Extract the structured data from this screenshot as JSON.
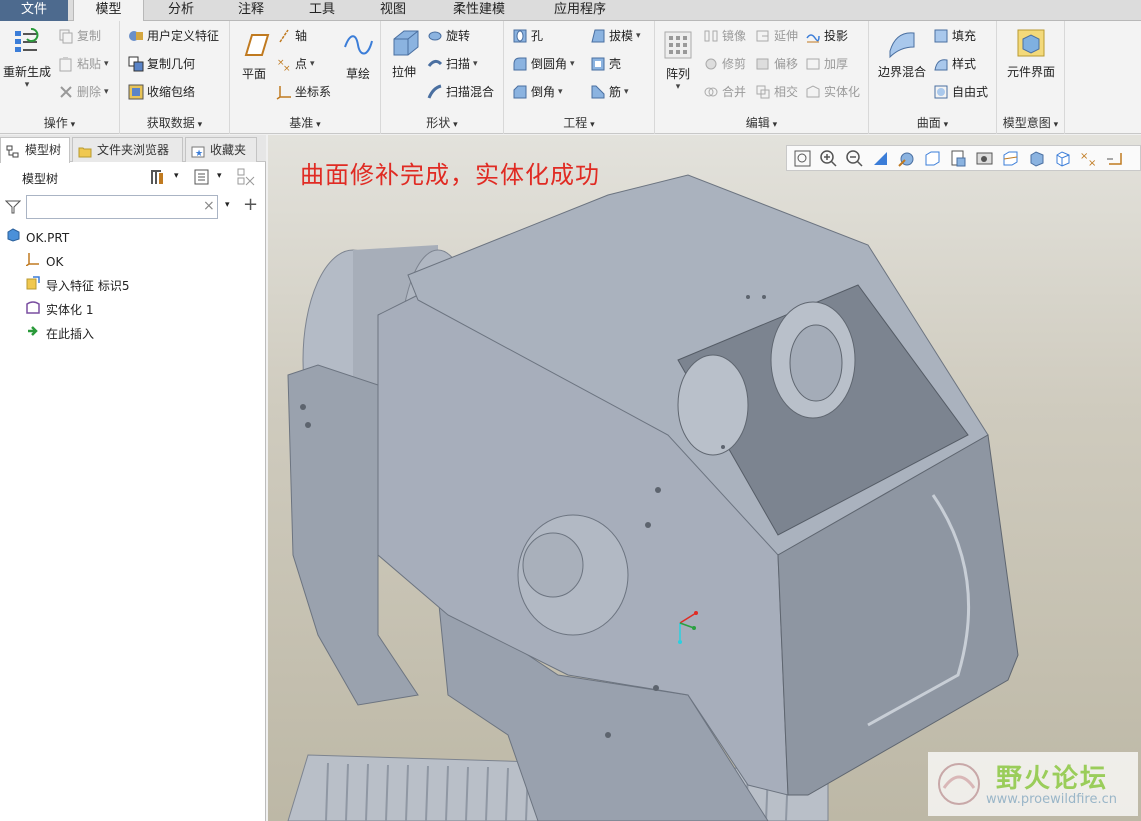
{
  "menu_tabs": [
    "文件",
    "模型",
    "分析",
    "注释",
    "工具",
    "视图",
    "柔性建模",
    "应用程序"
  ],
  "ribbon": {
    "groups": {
      "operations": "操作",
      "get_data": "获取数据",
      "datum": "基准",
      "shape": "形状",
      "engineering": "工程",
      "edit": "编辑",
      "surface": "曲面",
      "model_intent": "模型意图"
    },
    "regenerate": "重新生成",
    "copy": "复制",
    "paste": "粘贴",
    "delete": "删除",
    "udf": "用户定义特征",
    "copy_geometry": "复制几何",
    "shrinkwrap": "收缩包络",
    "plane": "平面",
    "axis": "轴",
    "point": "点",
    "csys": "坐标系",
    "sketch": "草绘",
    "extrude": "拉伸",
    "revolve": "旋转",
    "sweep": "扫描",
    "swept_blend": "扫描混合",
    "hole": "孔",
    "round": "倒圆角",
    "chamfer": "倒角",
    "draft": "拔模",
    "shell": "壳",
    "rib": "筋",
    "pattern": "阵列",
    "mirror": "镜像",
    "trim": "修剪",
    "merge": "合并",
    "extend": "延伸",
    "offset": "偏移",
    "intersect": "相交",
    "project": "投影",
    "thicken": "加厚",
    "solidify": "实体化",
    "boundary_blend": "边界混合",
    "fill": "填充",
    "style": "样式",
    "freestyle": "自由式",
    "component_interface": "元件界面"
  },
  "panel": {
    "tabs": [
      "模型树",
      "文件夹浏览器",
      "收藏夹"
    ],
    "tree_label": "模型树",
    "filter_placeholder": "",
    "items": [
      "OK.PRT",
      "OK",
      "导入特征 标识5",
      "实体化 1",
      "在此插入"
    ]
  },
  "viewport": {
    "annotation": "曲面修补完成，实体化成功",
    "watermark_title": "野火论坛",
    "watermark_url": "www.proewildfire.cn"
  },
  "colors": {
    "file_tab": "#4d6a8e",
    "annotation": "#e02b23",
    "model": "#a3abb8",
    "watermark_green": "#9acd5a"
  }
}
